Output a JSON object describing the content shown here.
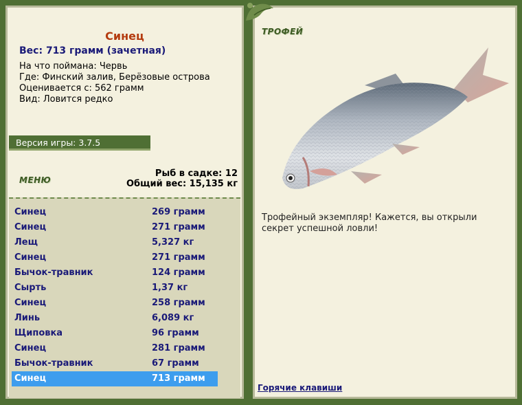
{
  "fish": {
    "name": "Синец",
    "weight_line": "Вес: 713 грамм (зачетная)",
    "bait": "На что поймана: Червь",
    "location": "Где: Финский залив, Берёзовые острова",
    "rated_from": "Оценивается с: 562 грамм",
    "rarity": "Вид: Ловится редко"
  },
  "version": "Версия игры: 3.7.5",
  "menu_label": "МЕНЮ",
  "keepnet": {
    "count": "Рыб в садке: 12",
    "total_weight": "Общий вес: 15,135 кг"
  },
  "catch_list": [
    {
      "name": "Синец",
      "weight": "269 грамм"
    },
    {
      "name": "Синец",
      "weight": "271 грамм"
    },
    {
      "name": "Лещ",
      "weight": "5,327 кг"
    },
    {
      "name": "Синец",
      "weight": "271 грамм"
    },
    {
      "name": "Бычок-травник",
      "weight": "124 грамм"
    },
    {
      "name": "Сырть",
      "weight": "1,37 кг"
    },
    {
      "name": "Синец",
      "weight": "258 грамм"
    },
    {
      "name": "Линь",
      "weight": "6,089 кг"
    },
    {
      "name": "Щиповка",
      "weight": "96 грамм"
    },
    {
      "name": "Синец",
      "weight": "281 грамм"
    },
    {
      "name": "Бычок-травник",
      "weight": "67 грамм"
    },
    {
      "name": "Синец",
      "weight": "713 грамм"
    }
  ],
  "selected_index": 11,
  "trophy": {
    "label": "ТРОФЕЙ",
    "message": "Трофейный экземпляр! Кажется, вы открыли секрет успешной ловли!"
  },
  "hotkeys_label": "Горячие клавиши",
  "colors": {
    "frame": "#4f6f34",
    "panel": "#f4f1df",
    "selection": "#3d9dee",
    "fish_title": "#b43c10",
    "link": "#1a1a78"
  }
}
